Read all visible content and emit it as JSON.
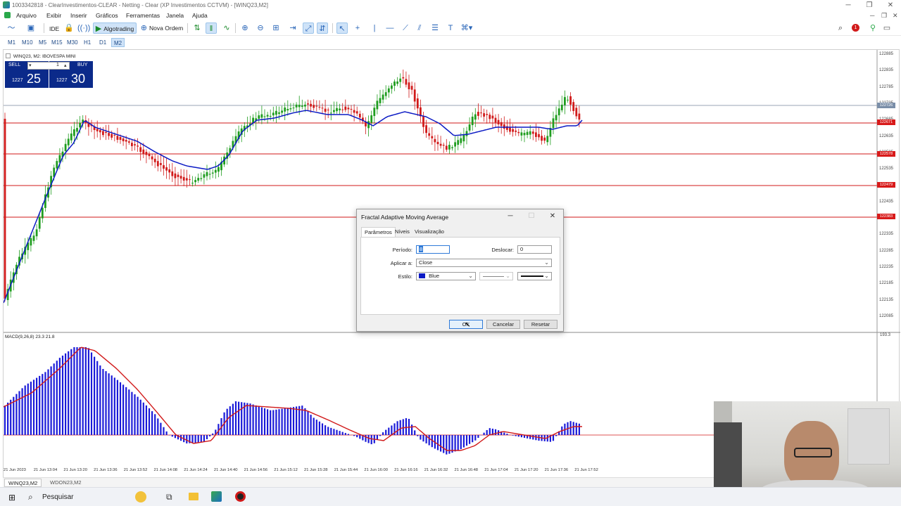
{
  "window": {
    "title": "1003342818 - ClearInvestimentos-CLEAR - Netting - Clear (XP Investimentos CCTVM) - [WINQ23,M2]",
    "controls": [
      "─",
      "❐",
      "✕"
    ]
  },
  "menu": {
    "items": [
      "Arquivo",
      "Exibir",
      "Inserir",
      "Gráficos",
      "Ferramentas",
      "Janela",
      "Ajuda"
    ]
  },
  "toolbar": {
    "ide_label": "IDE",
    "algotrading_label": "Algotrading",
    "nova_ordem_label": "Nova Ordem",
    "notification_count": "1"
  },
  "timeframes": {
    "items": [
      "M1",
      "M10",
      "M5",
      "M15",
      "M30",
      "H1",
      "D1",
      "M2"
    ],
    "active": "M2"
  },
  "chart": {
    "caption": "WINQ23, M2:  IBOVESPA MINI",
    "trade_panel": {
      "sell_label": "SELL",
      "buy_label": "BUY",
      "volume": "1",
      "sell_prefix": "1227",
      "sell_big": "25",
      "buy_prefix": "1227",
      "buy_big": "30"
    },
    "price_labels": [
      "122885",
      "122835",
      "122785",
      "122735",
      "122685",
      "122635",
      "122585",
      "122535",
      "122485",
      "122435",
      "122385",
      "122335",
      "122285",
      "122235",
      "122185",
      "122135",
      "122085"
    ],
    "price_tags": [
      "122726",
      "122671",
      "122578",
      "122479",
      "122383"
    ],
    "colors": {
      "bull": "#1f9d1f",
      "bear": "#d11a1a",
      "fama": "#0b1ac4",
      "level_line": "#d11a1a",
      "macd_hist": "#1a1ad8",
      "macd_signal": "#d11a1a"
    }
  },
  "macd": {
    "caption": "MACD(9,26,8) 23.3 21.8",
    "axis_top": "193.3"
  },
  "time_axis": {
    "labels": [
      "21 Jun 2023",
      "21 Jun 13:04",
      "21 Jun 13:20",
      "21 Jun 13:36",
      "21 Jun 13:52",
      "21 Jun 14:08",
      "21 Jun 14:24",
      "21 Jun 14:40",
      "21 Jun 14:56",
      "21 Jun 15:12",
      "21 Jun 15:28",
      "21 Jun 15:44",
      "21 Jun 16:00",
      "21 Jun 16:16",
      "21 Jun 16:32",
      "21 Jun 16:48",
      "21 Jun 17:04",
      "21 Jun 17:20",
      "21 Jun 17:36",
      "21 Jun 17:52"
    ]
  },
  "tabs": {
    "items": [
      "WINQ23,M2",
      "WDON23,M2"
    ]
  },
  "dialog": {
    "title": "Fractal Adaptive Moving Average",
    "tabs": [
      "Parâmetros",
      "Níveis",
      "Visualização"
    ],
    "periodo_label": "Período:",
    "periodo_value": "8",
    "deslocar_label": "Deslocar:",
    "deslocar_value": "0",
    "aplicar_label": "Aplicar a:",
    "aplicar_value": "Close",
    "estilo_label": "Estilo:",
    "estilo_color_name": "Blue",
    "estilo_color": "#0b1ac4",
    "ok_label": "OK",
    "cancel_label": "Cancelar",
    "reset_label": "Resetar"
  },
  "taskbar": {
    "search_placeholder": "Pesquisar"
  }
}
